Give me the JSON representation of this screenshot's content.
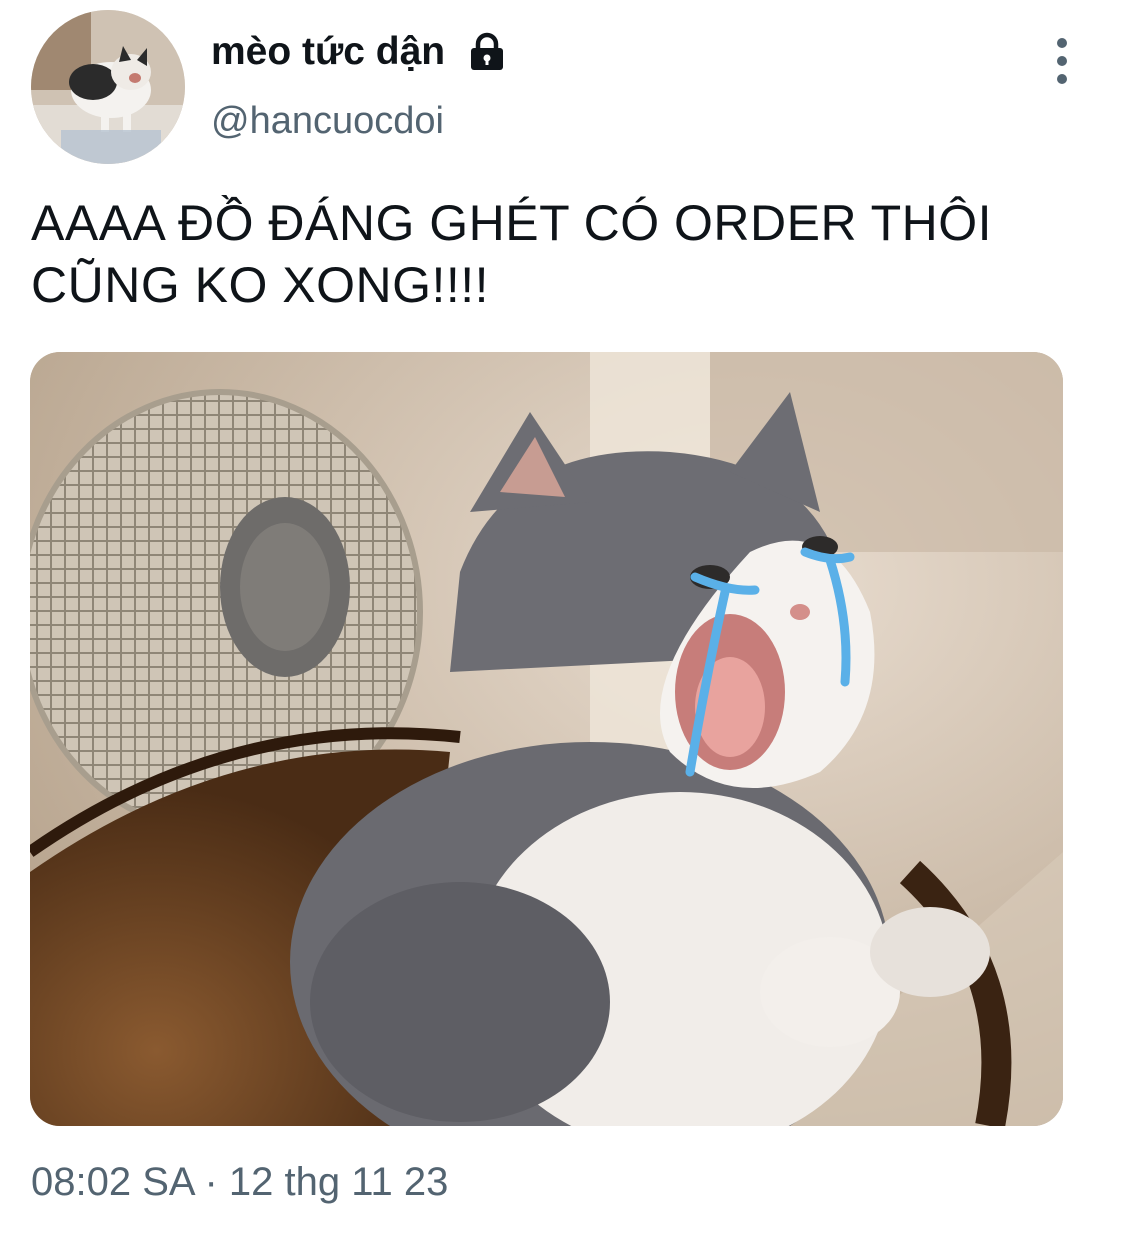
{
  "user": {
    "display_name": "mèo tức dận",
    "handle": "@hancuocdoi",
    "protected_icon": "lock-icon",
    "avatar": "cat-avatar"
  },
  "actions": {
    "more_icon": "more-vertical-icon"
  },
  "tweet": {
    "text": "AAAA ĐỒ ĐÁNG GHÉT CÓ ORDER THÔI\nCŨNG KO XONG!!!!",
    "media": "crying-cat-photo",
    "timestamp": "08:02 SA · 12 thg 11 23"
  },
  "colors": {
    "text_primary": "#0f1419",
    "text_secondary": "#536471",
    "tear_blue": "#5ab0e8"
  }
}
